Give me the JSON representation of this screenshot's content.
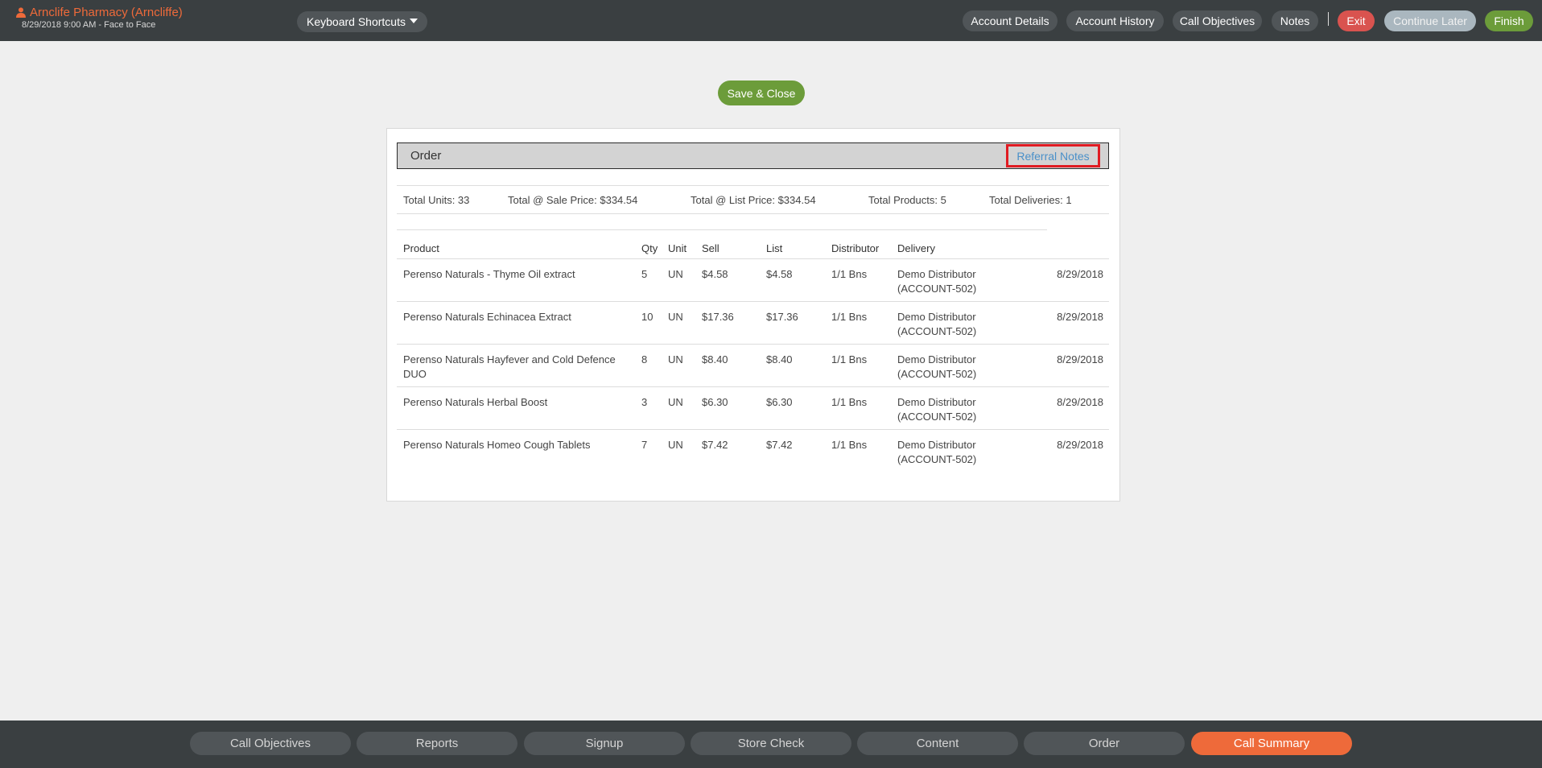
{
  "header": {
    "account_name": "Arnclife Pharmacy (Arncliffe)",
    "account_sub": "8/29/2018 9:00 AM - Face to Face",
    "keyboard_shortcuts": "Keyboard Shortcuts",
    "buttons": {
      "account_details": "Account Details",
      "account_history": "Account History",
      "call_objectives": "Call Objectives",
      "notes": "Notes",
      "separator": "|",
      "exit": "Exit",
      "continue_later": "Continue Later",
      "finish": "Finish"
    },
    "colors": {
      "accent": "#ee6a3a",
      "exit": "#d9534f",
      "finish": "#6c9c3a"
    }
  },
  "main": {
    "save_close": "Save & Close",
    "panel": {
      "title": "Order",
      "referral_notes": "Referral Notes",
      "totals": {
        "units": "Total Units: 33",
        "sale_price": "Total @ Sale Price: $334.54",
        "list_price": "Total @ List Price: $334.54",
        "products": "Total Products: 5",
        "deliveries": "Total Deliveries: 1"
      },
      "columns": {
        "product": "Product",
        "qty": "Qty",
        "unit": "Unit",
        "sell": "Sell",
        "list": "List",
        "distributor": "Distributor",
        "delivery": "Delivery"
      },
      "rows": [
        {
          "product": "Perenso Naturals - Thyme Oil extract",
          "qty": "5",
          "unit": "UN",
          "sell": "$4.58",
          "list": "$4.58",
          "distributor": "1/1 Bns",
          "delivery": "Demo Distributor (ACCOUNT-502)",
          "date": "8/29/2018"
        },
        {
          "product": "Perenso Naturals Echinacea Extract",
          "qty": "10",
          "unit": "UN",
          "sell": "$17.36",
          "list": "$17.36",
          "distributor": "1/1 Bns",
          "delivery": "Demo Distributor (ACCOUNT-502)",
          "date": "8/29/2018"
        },
        {
          "product": "Perenso Naturals Hayfever and Cold Defence DUO",
          "qty": "8",
          "unit": "UN",
          "sell": "$8.40",
          "list": "$8.40",
          "distributor": "1/1 Bns",
          "delivery": "Demo Distributor (ACCOUNT-502)",
          "date": "8/29/2018"
        },
        {
          "product": "Perenso Naturals Herbal Boost",
          "qty": "3",
          "unit": "UN",
          "sell": "$6.30",
          "list": "$6.30",
          "distributor": "1/1 Bns",
          "delivery": "Demo Distributor (ACCOUNT-502)",
          "date": "8/29/2018"
        },
        {
          "product": "Perenso Naturals Homeo Cough Tablets",
          "qty": "7",
          "unit": "UN",
          "sell": "$7.42",
          "list": "$7.42",
          "distributor": "1/1 Bns",
          "delivery": "Demo Distributor (ACCOUNT-502)",
          "date": "8/29/2018"
        }
      ]
    }
  },
  "footer": {
    "tabs": [
      {
        "label": "Call Objectives"
      },
      {
        "label": "Reports"
      },
      {
        "label": "Signup"
      },
      {
        "label": "Store Check"
      },
      {
        "label": "Content"
      },
      {
        "label": "Order"
      },
      {
        "label": "Call Summary",
        "active": true
      }
    ]
  }
}
